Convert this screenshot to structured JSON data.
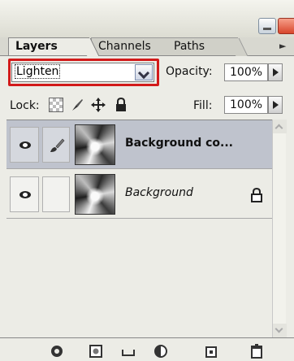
{
  "tabs": [
    {
      "label": "Layers"
    },
    {
      "label": "Channels"
    },
    {
      "label": "Paths"
    }
  ],
  "panel_menu_icon": "triangle-right",
  "blend_mode": {
    "selected": "Lighten"
  },
  "opacity": {
    "label": "Opacity:",
    "value": "100%"
  },
  "lock": {
    "label": "Lock:",
    "icons": [
      "lock-transparent-icon",
      "lock-image-icon",
      "lock-position-icon",
      "lock-all-icon"
    ]
  },
  "fill": {
    "label": "Fill:",
    "value": "100%"
  },
  "layers": [
    {
      "name": "Background co...",
      "visible": true,
      "selected": true,
      "linked_icon": "brush-icon"
    },
    {
      "name": "Background",
      "visible": true,
      "selected": false,
      "locked": true
    }
  ],
  "footer_icons": [
    "link-layers-icon",
    "add-layer-style-icon",
    "add-mask-icon",
    "new-group-icon",
    "new-adjustment-layer-icon",
    "new-layer-icon",
    "delete-layer-icon"
  ],
  "colors": {
    "highlight": "#d21a1a",
    "selected_row": "#bfc3cd",
    "panel": "#ecece6"
  }
}
